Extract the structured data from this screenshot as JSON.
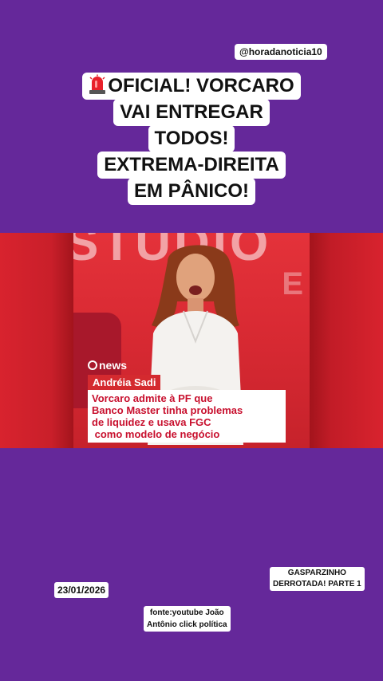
{
  "handle": "@horadanoticia10",
  "headline": {
    "icon": "police-siren-icon",
    "lines": [
      "OFICIAL! VORCARO",
      "VAI ENTREGAR",
      "TODOS!",
      "EXTREMA-DIREITA",
      "EM PÂNICO!"
    ]
  },
  "video": {
    "background_word": "STUDIO",
    "background_letters": "E",
    "channel_logo": "news",
    "presenter_name": "Andréia Sadi",
    "caption_lines": [
      "Vorcaro admite à PF que",
      "Banco Master tinha problemas",
      "de liquidez e usava FGC",
      " como modelo de negócio"
    ]
  },
  "date": "23/01/2026",
  "part_label": {
    "line1": "GASPARZINHO",
    "line2": "DERROTADA! PARTE 1"
  },
  "source": {
    "line1": "fonte:youtube João",
    "line2": "Antônio click política"
  },
  "colors": {
    "background": "#65289a",
    "video_red": "#d8232e",
    "caption_red": "#c8102e"
  }
}
